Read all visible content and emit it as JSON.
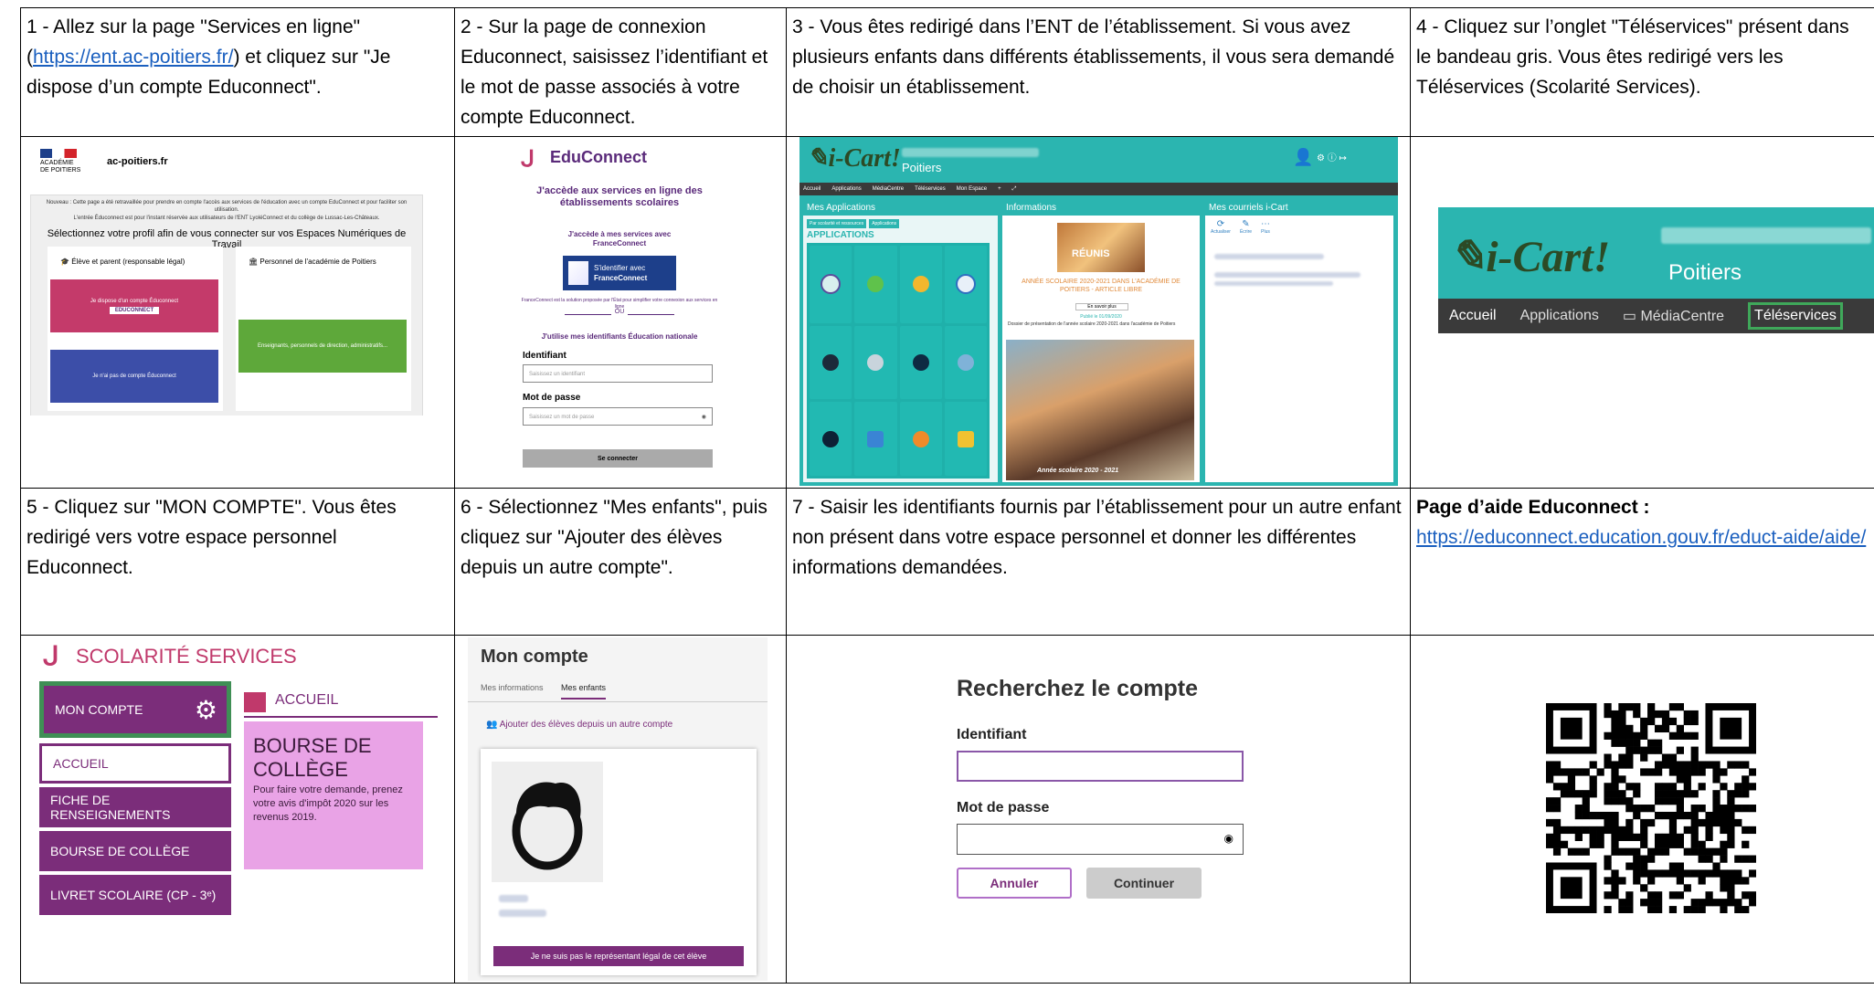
{
  "steps": {
    "s1": {
      "text_a": "1 - Allez sur la page \"Services en ligne\" (",
      "link": "https://ent.ac-poitiers.fr/",
      "text_b": ") et cliquez sur \"Je dispose d’un compte Educonnect\"."
    },
    "s2": {
      "text": "2 - Sur la page de connexion Educonnect, saisissez l’identifiant et le mot de passe associés à votre compte Educonnect."
    },
    "s3": {
      "text": "3 - Vous êtes redirigé dans l’ENT de l’établissement. Si vous avez plusieurs enfants dans différents établissements, il vous sera demandé de choisir un établissement."
    },
    "s4": {
      "text": "4 - Cliquez sur l’onglet \"Téléservices\" présent dans le bandeau gris. Vous êtes redirigé vers les Téléservices (Scolarité Services)."
    },
    "s5": {
      "text": "5 - Cliquez sur \"MON COMPTE\". Vous êtes redirigé vers votre espace personnel Educonnect."
    },
    "s6": {
      "text": "6 - Sélectionnez \"Mes enfants\", puis cliquez sur \"Ajouter des élèves depuis un autre compte\"."
    },
    "s7": {
      "text": "7 - Saisir les identifiants fournis par l’établissement pour un autre enfant non présent dans votre espace personnel et donner les différentes informations demandées."
    },
    "help": {
      "title": "Page d’aide Educonnect :",
      "link": "https://educonnect.education.gouv.fr/educt-aide/aide/"
    }
  },
  "shot1": {
    "academy": "ACADÉMIE DE POITIERS",
    "site": "ac-poitiers.fr",
    "notice1": "Nouveau : Cette page a été retravaillée pour prendre en compte l'accès aux services de l'éducation avec un compte EduConnect et pour faciliter son utilisation.",
    "notice2": "L'entrée Éduconnect est pour l'instant réservée aux utilisateurs de l'ENT LyoléConnect et du collège de Lussac-Les-Châteaux.",
    "heading": "Sélectionnez votre profil afin de vous connecter sur vos Espaces Numériques de Travail",
    "profile_left": "Élève et parent (responsable légal)",
    "profile_right": "Personnel de l'académie de Poitiers",
    "btn_has_account": "Je dispose d'un compte Éduconnect",
    "btn_educonnect": "EDUCONNECT",
    "btn_no_account": "Je n'ai pas de compte Éduconnect",
    "btn_staff": "Enseignants, personnels de direction, administratifs..."
  },
  "shot2": {
    "brand": "EduConnect",
    "intro": "J'accède aux services en ligne des établissements scolaires",
    "with_fc": "J'accède à mes services avec FranceConnect",
    "fc_btn_line1": "S'identifier avec",
    "fc_btn_line2": "FranceConnect",
    "fc_note": "FranceConnect est la solution proposée par l'État pour simplifier votre connexion aux services en ligne",
    "or": "OU",
    "use_ids": "J'utilise mes identifiants Éducation nationale",
    "id_label": "Identifiant",
    "id_placeholder": "Saisissez un identifiant",
    "pw_label": "Mot de passe",
    "pw_placeholder": "Saisissez un mot de passe",
    "submit": "Se connecter"
  },
  "shot3": {
    "logo": "i-Cart!",
    "city": "Poitiers",
    "nav": [
      "Accueil",
      "Applications",
      "MédiaCentre",
      "Téléservices",
      "Mon Espace"
    ],
    "panel_apps": "Mes Applications",
    "apps_tabs": [
      "Par scolarité et ressources",
      "Applications"
    ],
    "apps_heading": "APPLICATIONS",
    "panel_info": "Informations",
    "info_reunis": "RÉUNIS",
    "info_title": "ANNÉE SCOLAIRE 2020-2021 DANS L'ACADÉMIE DE POITIERS - ARTICLE LIBRE",
    "info_more": "En savoir plus",
    "info_date": "Publié le 01/09/2020",
    "info_desc": "Dossier de présentation de l'année scolaire 2020-2021 dans l'académie de Poitiers",
    "info_caption": "Année scolaire 2020 - 2021",
    "panel_mail": "Mes courriels i-Cart",
    "mail_actions": [
      "Actualiser",
      "Écrire",
      "Plus"
    ]
  },
  "shot4": {
    "logo": "i-Cart!",
    "city": "Poitiers",
    "nav": [
      "Accueil",
      "Applications",
      "MédiaCentre",
      "Téléservices"
    ]
  },
  "shot5": {
    "brand": "SCOLARITÉ SERVICES",
    "menu": [
      "MON COMPTE",
      "ACCUEIL",
      "FICHE DE RENSEIGNEMENTS",
      "BOURSE DE COLLÈGE",
      "LIVRET SCOLAIRE (CP - 3ᵉ)"
    ],
    "home": "ACCUEIL",
    "card_title": "BOURSE DE COLLÈGE",
    "card_text": "Pour faire votre demande, prenez votre avis d'impôt 2020 sur les revenus 2019."
  },
  "shot6": {
    "title": "Mon compte",
    "tab_info": "Mes informations",
    "tab_children": "Mes enfants",
    "add_link": "Ajouter des élèves depuis un autre compte",
    "not_guardian": "Je ne suis pas le représentant légal de cet élève"
  },
  "shot7": {
    "title": "Recherchez le compte",
    "id_label": "Identifiant",
    "pw_label": "Mot de passe",
    "cancel": "Annuler",
    "continue": "Continuer"
  },
  "colors": {
    "educonnect": "#5a2a7a",
    "ent_teal": "#2bb5b0",
    "ent_dark": "#3a3a3a",
    "scolarite_purple": "#7b2d7a",
    "scolarite_green": "#3f8f55",
    "scolarite_pink": "#e9a3e6"
  }
}
